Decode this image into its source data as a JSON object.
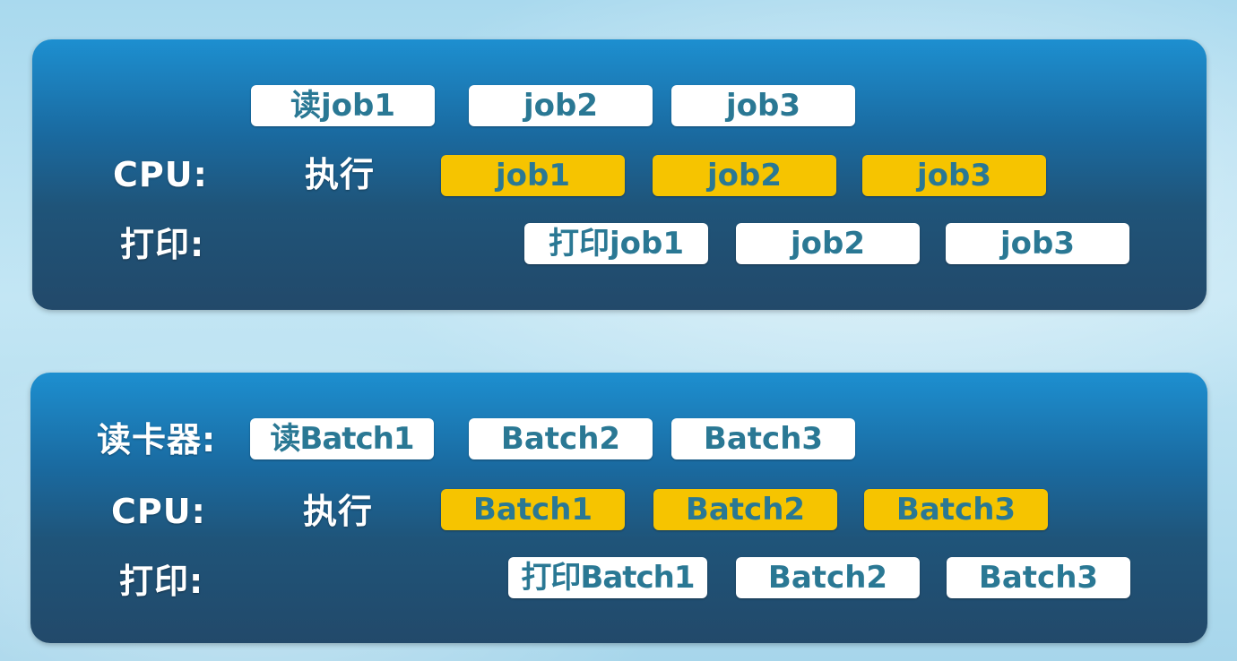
{
  "top_panel": {
    "read_boxes": [
      "读job1",
      "job2",
      "job3"
    ],
    "cpu_label": "CPU:",
    "exec_label": "执行",
    "cpu_boxes": [
      "job1",
      "job2",
      "job3"
    ],
    "print_label": "打印:",
    "print_boxes": [
      "打印job1",
      "job2",
      "job3"
    ]
  },
  "bottom_panel": {
    "reader_label": "读卡器:",
    "read_boxes": [
      "读Batch1",
      "Batch2",
      "Batch3"
    ],
    "cpu_label": "CPU:",
    "exec_label": "执行",
    "cpu_boxes": [
      "Batch1",
      "Batch2",
      "Batch3"
    ],
    "print_label": "打印:",
    "print_boxes": [
      "打印Batch1",
      "Batch2",
      "Batch3"
    ]
  },
  "colors": {
    "white_box": "#ffffff",
    "cpu_box": "#f6c400",
    "box_text": "#2a7894",
    "panel_dark": "#22496a",
    "panel_light": "#1d8fd0"
  }
}
